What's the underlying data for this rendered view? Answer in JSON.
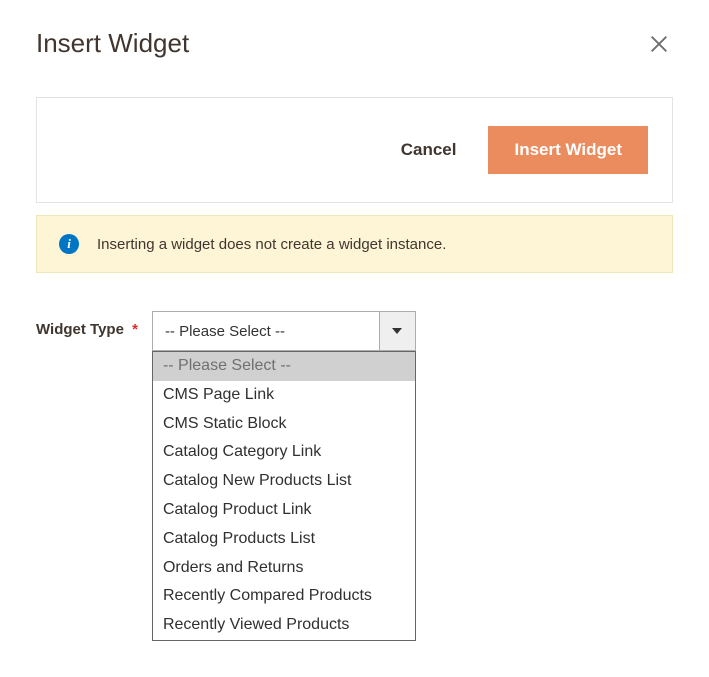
{
  "modal": {
    "title": "Insert Widget"
  },
  "toolbar": {
    "cancel_label": "Cancel",
    "insert_label": "Insert Widget"
  },
  "info": {
    "message": "Inserting a widget does not create a widget instance."
  },
  "form": {
    "widget_type": {
      "label": "Widget Type",
      "required_mark": "*",
      "selected": "-- Please Select --",
      "options": [
        "-- Please Select --",
        "CMS Page Link",
        "CMS Static Block",
        "Catalog Category Link",
        "Catalog New Products List",
        "Catalog Product Link",
        "Catalog Products List",
        "Orders and Returns",
        "Recently Compared Products",
        "Recently Viewed Products"
      ]
    }
  }
}
